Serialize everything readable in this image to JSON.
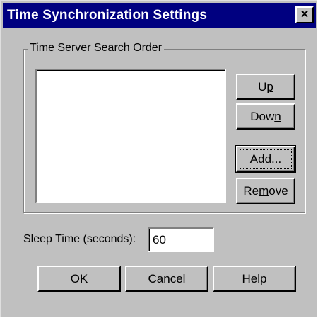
{
  "window": {
    "title": "Time Synchronization Settings",
    "close_glyph": "✕"
  },
  "server_group": {
    "legend": "Time Server Search Order",
    "servers": [],
    "buttons": {
      "up": {
        "pre": "U",
        "accel": "p",
        "post": ""
      },
      "down": {
        "pre": "Dow",
        "accel": "n",
        "post": ""
      },
      "add": {
        "pre": "",
        "accel": "A",
        "post": "dd..."
      },
      "remove": {
        "pre": "Re",
        "accel": "m",
        "post": "ove"
      }
    }
  },
  "sleep": {
    "label": "Sleep Time (seconds):",
    "value": "60"
  },
  "footer": {
    "ok_label": "OK",
    "cancel_label": "Cancel",
    "help_label": "Help"
  }
}
